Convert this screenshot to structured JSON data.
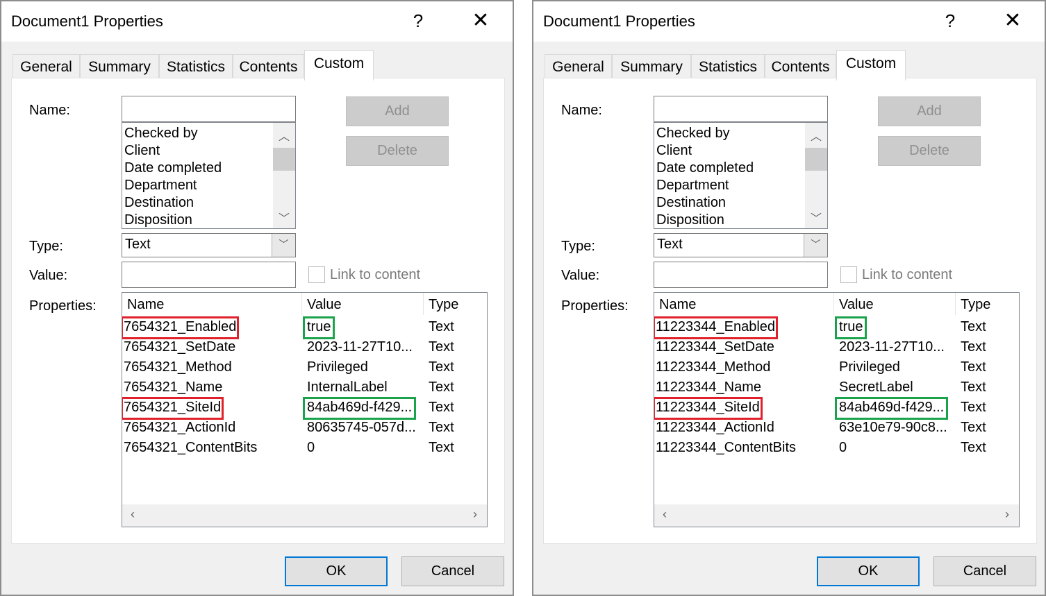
{
  "colors": {
    "highlight_red": "#e0202a",
    "highlight_green": "#1aa34a",
    "default_button_border": "#0078d7"
  },
  "dialogs": [
    {
      "title": "Document1 Properties",
      "help": "?",
      "close": "✕",
      "tabs": [
        "General",
        "Summary",
        "Statistics",
        "Contents",
        "Custom"
      ],
      "active_tab": "Custom",
      "labels": {
        "name": "Name:",
        "type": "Type:",
        "value": "Value:",
        "properties": "Properties:"
      },
      "name_value": "",
      "name_list": [
        "Checked by",
        "Client",
        "Date completed",
        "Department",
        "Destination",
        "Disposition"
      ],
      "type_value": "Text",
      "value_value": "",
      "link_to_content": "Link to content",
      "buttons": {
        "add": "Add",
        "delete": "Delete",
        "ok": "OK",
        "cancel": "Cancel"
      },
      "columns": [
        "Name",
        "Value",
        "Type"
      ],
      "rows": [
        {
          "name": "7654321_Enabled",
          "value": "true",
          "type": "Text",
          "hl_name": "red",
          "hl_value": "green"
        },
        {
          "name": "7654321_SetDate",
          "value": "2023-11-27T10...",
          "type": "Text"
        },
        {
          "name": "7654321_Method",
          "value": "Privileged",
          "type": "Text"
        },
        {
          "name": "7654321_Name",
          "value": "InternalLabel",
          "type": "Text"
        },
        {
          "name": "7654321_SiteId",
          "value": "84ab469d-f429...",
          "type": "Text",
          "hl_name": "red",
          "hl_value": "green"
        },
        {
          "name": "7654321_ActionId",
          "value": "80635745-057d...",
          "type": "Text"
        },
        {
          "name": "7654321_ContentBits",
          "value": "0",
          "type": "Text"
        }
      ]
    },
    {
      "title": "Document1 Properties",
      "help": "?",
      "close": "✕",
      "tabs": [
        "General",
        "Summary",
        "Statistics",
        "Contents",
        "Custom"
      ],
      "active_tab": "Custom",
      "labels": {
        "name": "Name:",
        "type": "Type:",
        "value": "Value:",
        "properties": "Properties:"
      },
      "name_value": "",
      "name_list": [
        "Checked by",
        "Client",
        "Date completed",
        "Department",
        "Destination",
        "Disposition"
      ],
      "type_value": "Text",
      "value_value": "",
      "link_to_content": "Link to content",
      "buttons": {
        "add": "Add",
        "delete": "Delete",
        "ok": "OK",
        "cancel": "Cancel"
      },
      "columns": [
        "Name",
        "Value",
        "Type"
      ],
      "rows": [
        {
          "name": "11223344_Enabled",
          "value": "true",
          "type": "Text",
          "hl_name": "red",
          "hl_value": "green"
        },
        {
          "name": "11223344_SetDate",
          "value": "2023-11-27T10...",
          "type": "Text"
        },
        {
          "name": "11223344_Method",
          "value": "Privileged",
          "type": "Text"
        },
        {
          "name": "11223344_Name",
          "value": "SecretLabel",
          "type": "Text"
        },
        {
          "name": "11223344_SiteId",
          "value": "84ab469d-f429...",
          "type": "Text",
          "hl_name": "red",
          "hl_value": "green"
        },
        {
          "name": "11223344_ActionId",
          "value": "63e10e79-90c8...",
          "type": "Text"
        },
        {
          "name": "11223344_ContentBits",
          "value": "0",
          "type": "Text"
        }
      ]
    }
  ]
}
